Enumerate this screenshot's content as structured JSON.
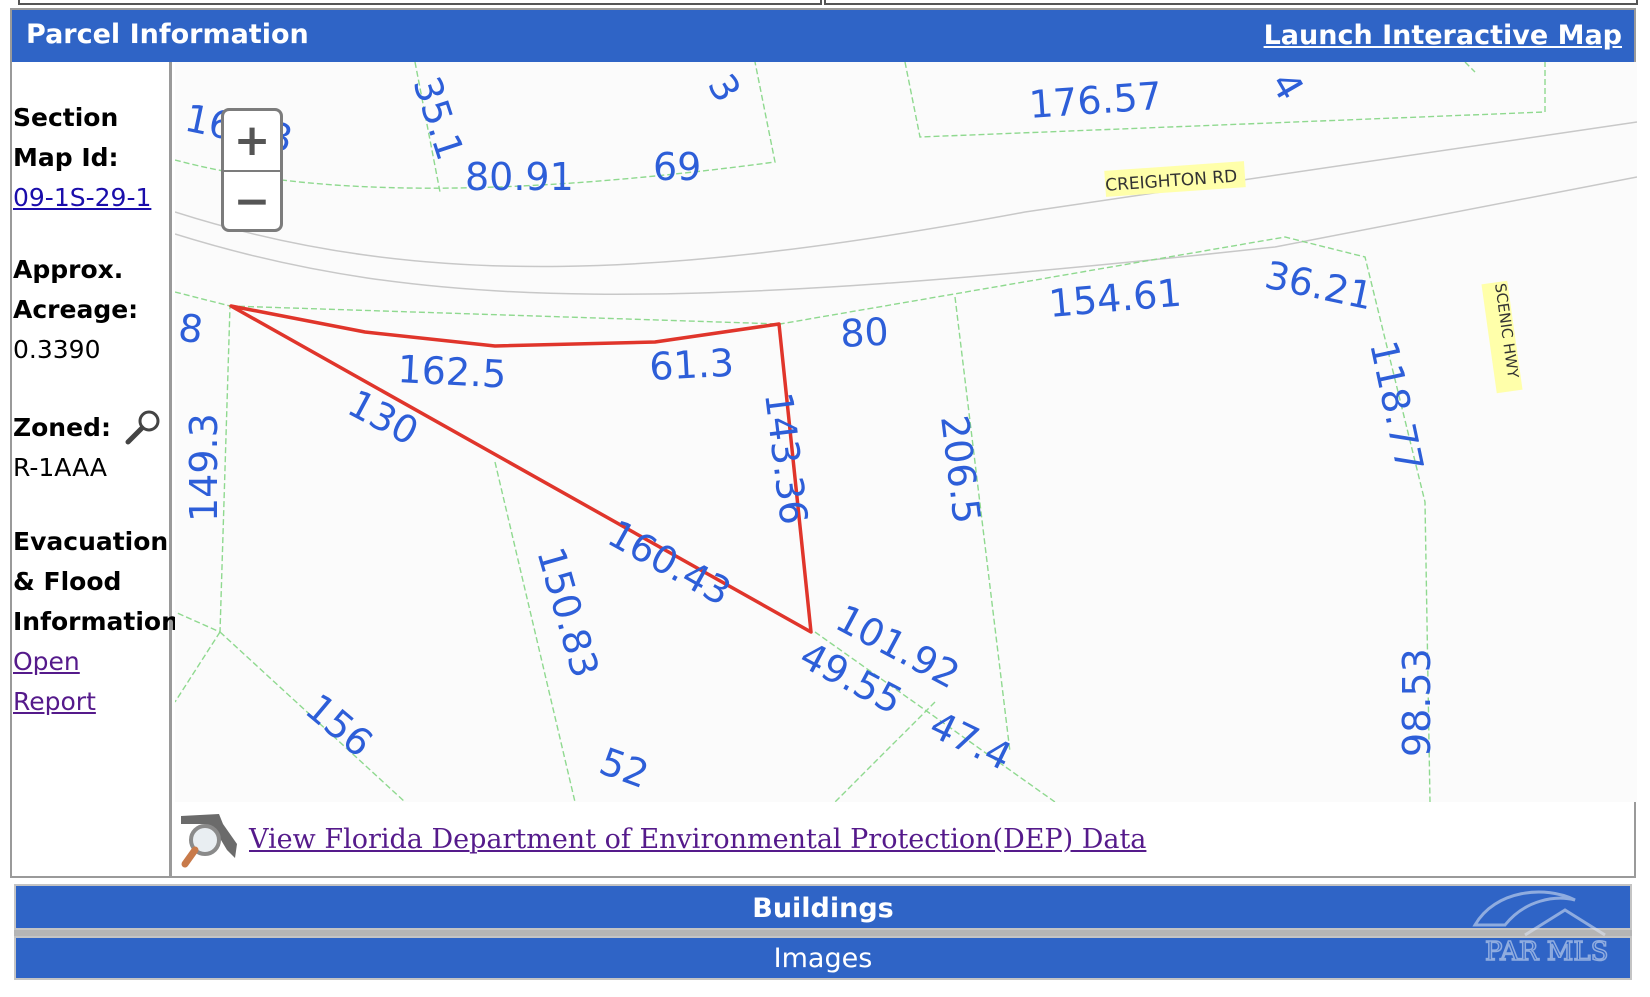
{
  "header": {
    "title": "Parcel Information",
    "launch_link": "Launch Interactive Map"
  },
  "sidebar": {
    "section_map_label_1": "Section",
    "section_map_label_2": "Map Id:",
    "section_map_value": "09-1S-29-1",
    "acreage_label_1": "Approx.",
    "acreage_label_2": "Acreage:",
    "acreage_value": "0.3390",
    "zoned_label": "Zoned:",
    "zoned_value": "R-1AAA",
    "evac_label_1": "Evacuation",
    "evac_label_2": "& Flood",
    "evac_label_3": "Information",
    "report_link_1": "Open",
    "report_link_2": "Report"
  },
  "map": {
    "zoom_in": "+",
    "zoom_out": "−",
    "road_1": "CREIGHTON RD",
    "road_2": "SCENIC HWY",
    "parcel_highlight_color": "#e0352b",
    "dimensions": [
      "16.33",
      "35.1",
      "3",
      "176.57",
      "4",
      "80.91",
      "69",
      "8",
      "162.5",
      "61.3",
      "80",
      "154.61",
      "36.21",
      "130",
      "143.36",
      "206.5",
      "118.77",
      "149.3",
      "150.83",
      "160.43",
      "101.92",
      "49.55",
      "47.4",
      "156",
      "52",
      "98.53"
    ]
  },
  "dep_link": "View Florida Department of Environmental Protection(DEP) Data",
  "sections": {
    "buildings": "Buildings",
    "images": "Images"
  },
  "watermark": "PAR MLS"
}
